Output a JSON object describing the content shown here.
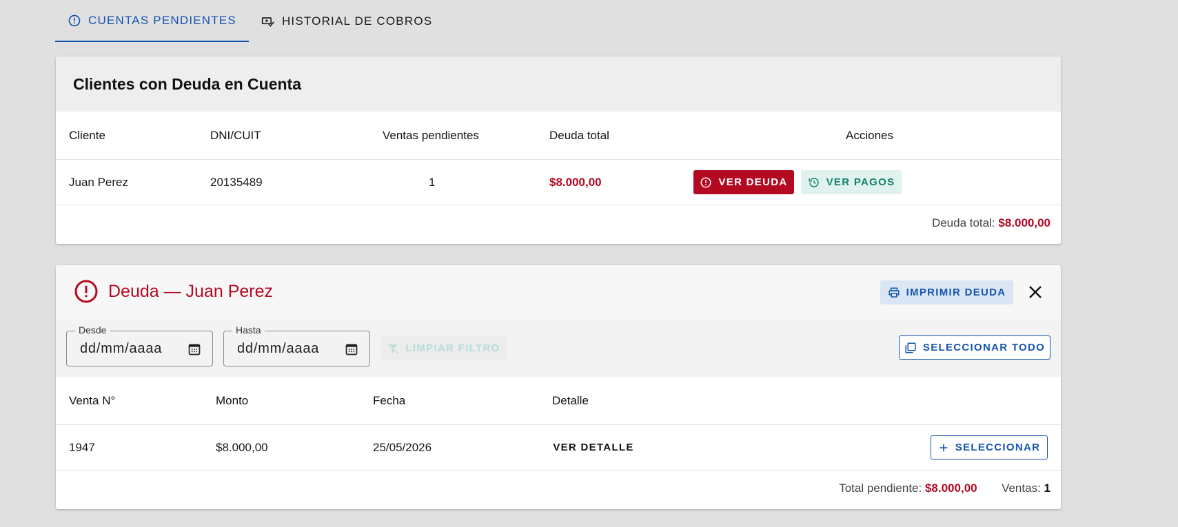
{
  "tabs": [
    {
      "label": "CUENTAS PENDIENTES",
      "icon": "alert-circle-icon",
      "active": true
    },
    {
      "label": "HISTORIAL DE COBROS",
      "icon": "cash-check-icon",
      "active": false
    }
  ],
  "clients_card": {
    "title": "Clientes con Deuda en Cuenta",
    "columns": [
      "Cliente",
      "DNI/CUIT",
      "Ventas pendientes",
      "Deuda total",
      "Acciones"
    ],
    "rows": [
      {
        "cliente": "Juan Perez",
        "dni": "20135489",
        "ventas": "1",
        "deuda": "$8.000,00",
        "ver_deuda_label": "VER DEUDA",
        "ver_pagos_label": "VER PAGOS"
      }
    ],
    "footer_label": "Deuda total:",
    "footer_value": "$8.000,00"
  },
  "debt_card": {
    "title": "Deuda — Juan Perez",
    "print_label": "IMPRIMIR DEUDA",
    "filters": {
      "desde_label": "Desde",
      "desde_value": "dd/mm/aaaa",
      "hasta_label": "Hasta",
      "hasta_value": "dd/mm/aaaa",
      "clear_label": "LIMPIAR FILTRO",
      "select_all_label": "SELECCIONAR TODO"
    },
    "columns": [
      "Venta N°",
      "Monto",
      "Fecha",
      "Detalle"
    ],
    "rows": [
      {
        "venta": "1947",
        "monto": "$8.000,00",
        "fecha": "25/05/2026",
        "detail_label": "VER DETALLE",
        "select_label": "SELECCIONAR"
      }
    ],
    "footer_total_label": "Total pendiente:",
    "footer_total_value": "$8.000,00",
    "footer_count_label": "Ventas:",
    "footer_count_value": "1"
  },
  "colors": {
    "primary": "#1553b0",
    "danger": "#b30a22",
    "teal": "#13806b"
  }
}
